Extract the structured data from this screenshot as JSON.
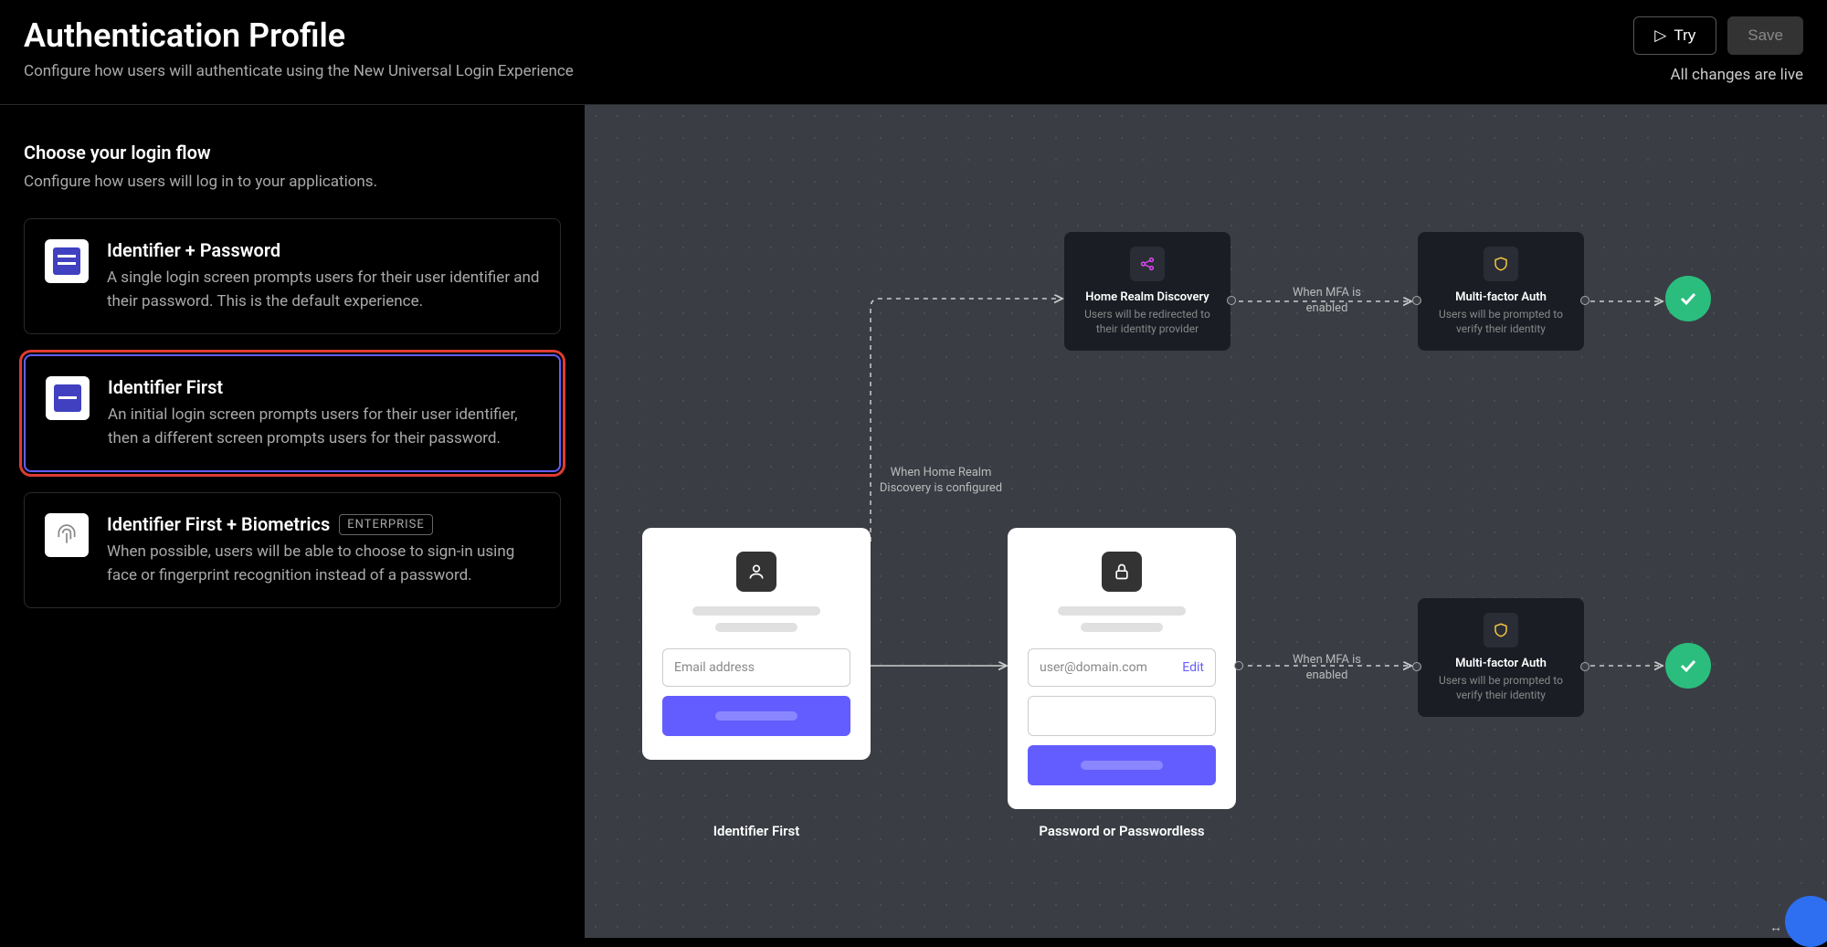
{
  "header": {
    "title": "Authentication Profile",
    "subtitle": "Configure how users will authenticate using the New Universal Login Experience",
    "try_label": "Try",
    "save_label": "Save",
    "live_text": "All changes are live"
  },
  "sidebar": {
    "title": "Choose your login flow",
    "desc": "Configure how users will log in to your applications.",
    "options": [
      {
        "title": "Identifier + Password",
        "desc": "A single login screen prompts users for their user identifier and their password. This is the default experience.",
        "selected": false,
        "icon": "form-double"
      },
      {
        "title": "Identifier First",
        "desc": "An initial login screen prompts users for their user identifier, then a different screen prompts users for their password.",
        "selected": true,
        "icon": "form-single"
      },
      {
        "title": "Identifier First + Biometrics",
        "desc": "When possible, users will be able to choose to sign-in using face or fingerprint recognition instead of a password.",
        "selected": false,
        "icon": "fingerprint",
        "badge": "ENTERPRISE"
      }
    ]
  },
  "canvas": {
    "hrd": {
      "title": "Home Realm Discovery",
      "desc": "Users will be redirected to their identity provider"
    },
    "mfa_top": {
      "title": "Multi-factor Auth",
      "desc": "Users will be prompted to verify their identity"
    },
    "mfa_bottom": {
      "title": "Multi-factor Auth",
      "desc": "Users will be prompted to verify their identity"
    },
    "id_first": {
      "placeholder": "Email address",
      "label": "Identifier First"
    },
    "pwd": {
      "value": "user@domain.com",
      "edit": "Edit",
      "label": "Password or Passwordless"
    },
    "edge_hrd": "When Home Realm Discovery is configured",
    "edge_mfa_top": "When MFA is enabled",
    "edge_mfa_bottom": "When MFA is enabled"
  }
}
